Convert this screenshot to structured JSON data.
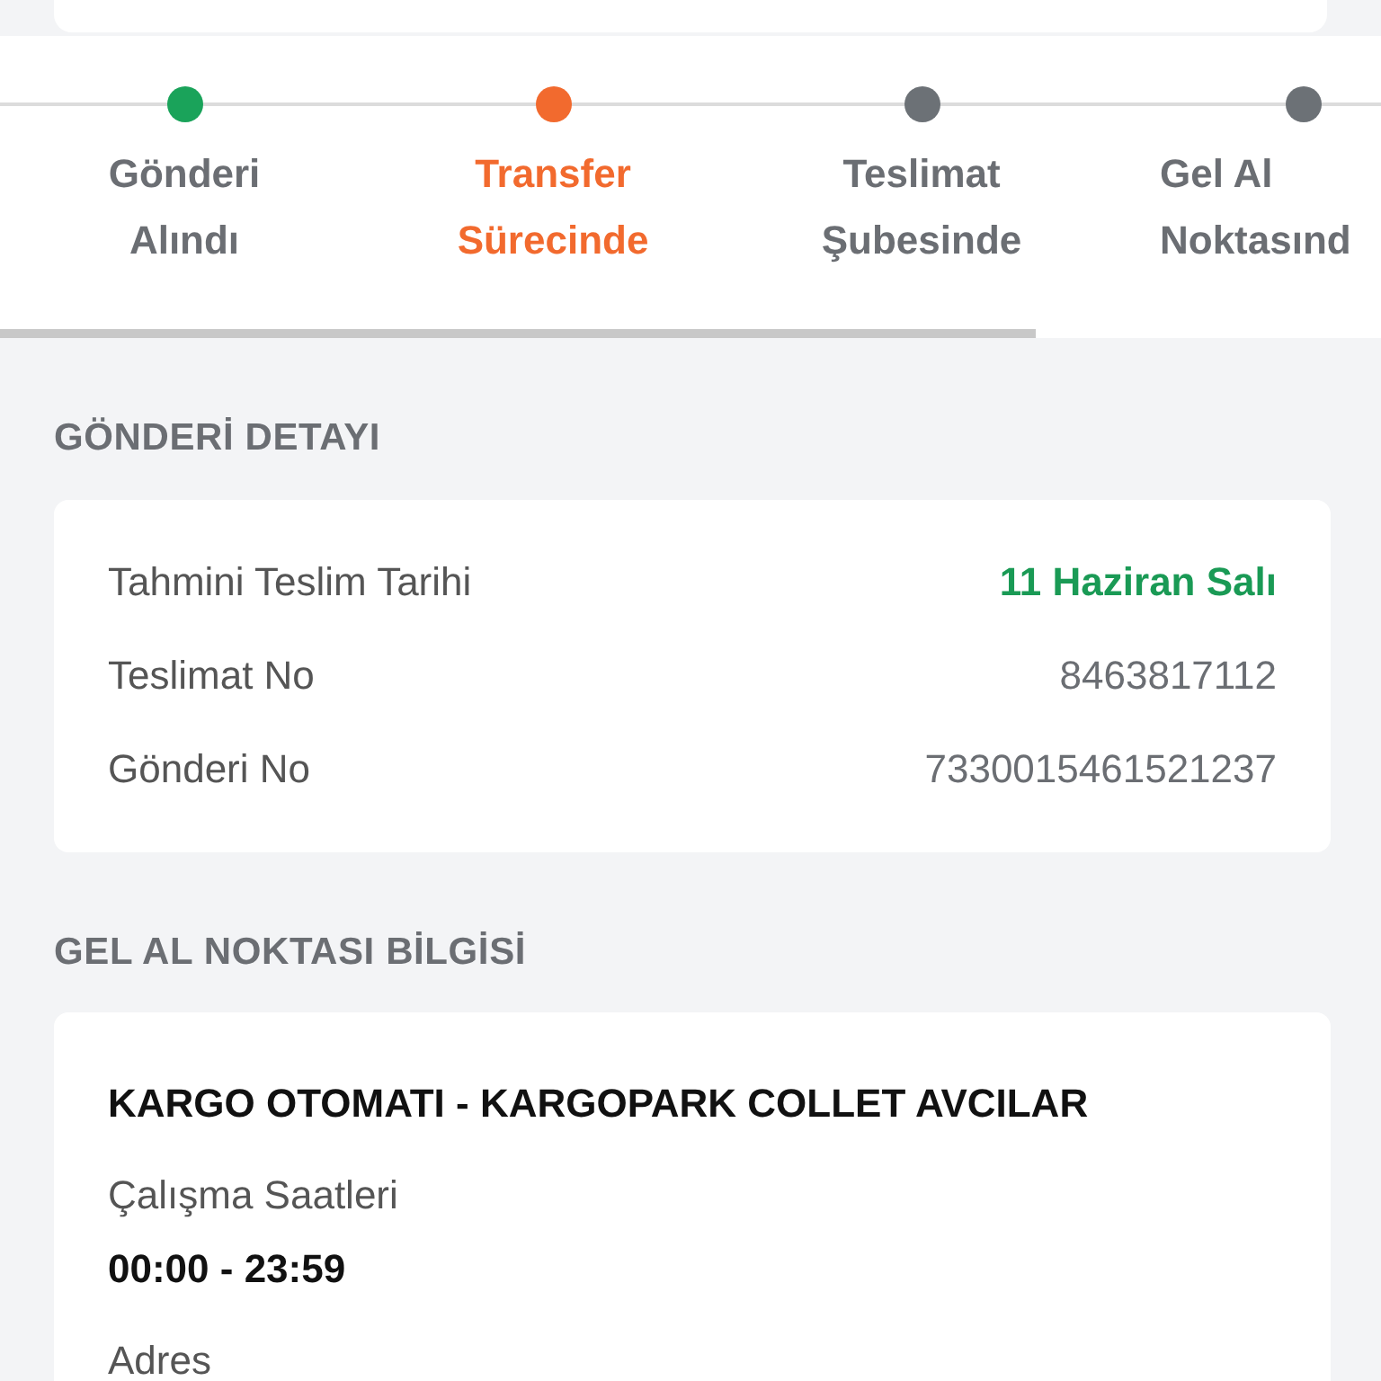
{
  "tracker": {
    "steps": [
      {
        "line1": "Gönderi",
        "line2": "Alındı",
        "completed": true,
        "current": false
      },
      {
        "line1": "Transfer",
        "line2": "Sürecinde",
        "completed": false,
        "current": true
      },
      {
        "line1": "Teslimat",
        "line2": "Şubesinde",
        "completed": false,
        "current": false
      },
      {
        "line1": "Gel Al",
        "line2": "Noktasınd",
        "completed": false,
        "current": false
      }
    ],
    "progress": {
      "level": 0.75
    }
  },
  "shipment_details": {
    "heading": "GÖNDERİ DETAYI",
    "rows": [
      {
        "label": "Tahmini Teslim Tarihi",
        "value": "11 Haziran Salı",
        "highlight": true
      },
      {
        "label": "Teslimat No",
        "value": "8463817112",
        "highlight": false
      },
      {
        "label": "Gönderi No",
        "value": "7330015461521237",
        "highlight": false
      }
    ]
  },
  "pickup_point": {
    "heading": "GEL AL NOKTASI BİLGİSİ",
    "name": "KARGO OTOMATI - KARGOPARK COLLET AVCILAR",
    "hours_label": "Çalışma Saatleri",
    "hours": "00:00 - 23:59",
    "address_label": "Adres"
  }
}
